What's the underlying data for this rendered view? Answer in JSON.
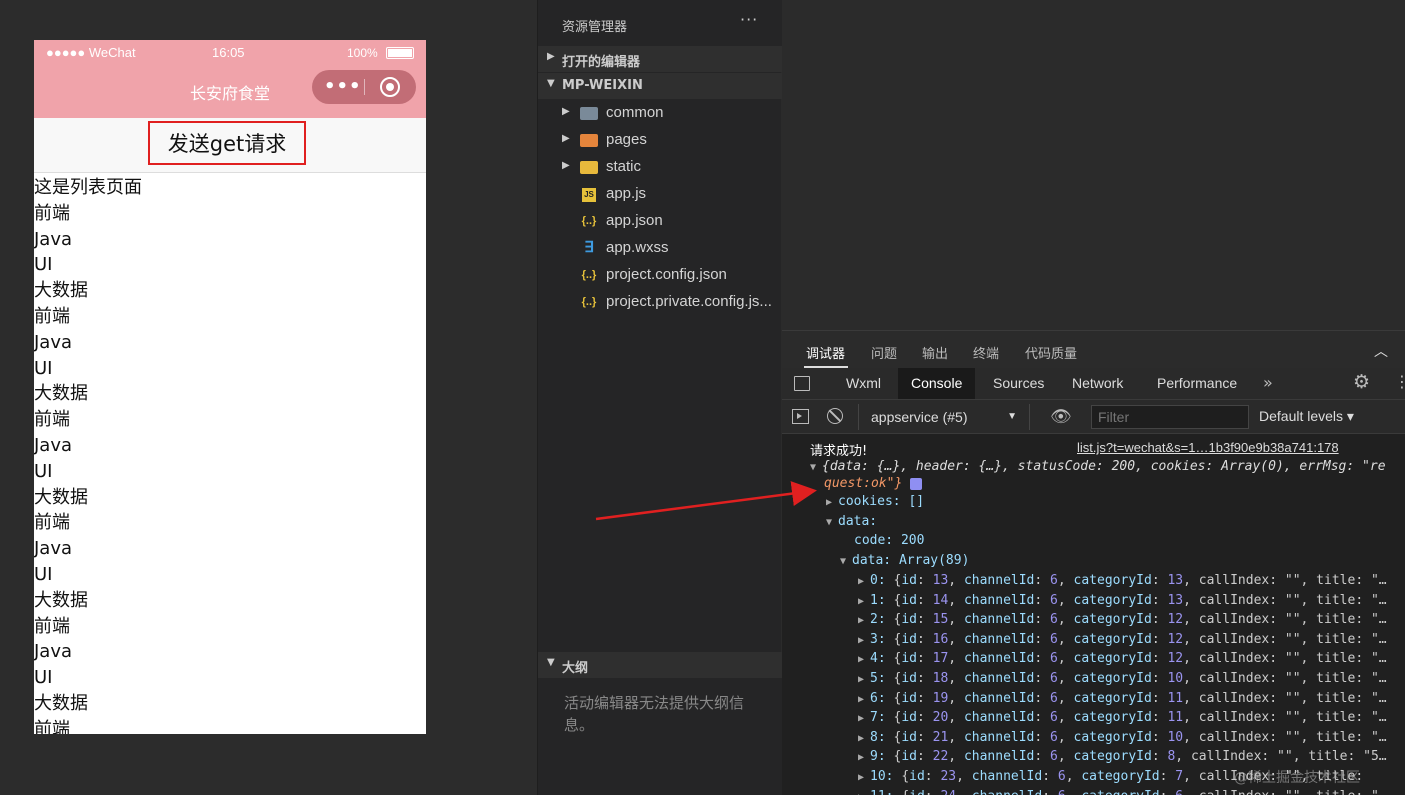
{
  "simulator": {
    "carrier": "●●●●● WeChat",
    "time": "16:05",
    "battery": "100%",
    "nav_title": "长安府食堂",
    "capsule_dots": "•••",
    "button_label": "发送get请求",
    "list_title": "这是列表页面",
    "list_items": [
      "前端",
      "Java",
      "UI",
      "大数据",
      "前端",
      "Java",
      "UI",
      "大数据",
      "前端",
      "Java",
      "UI",
      "大数据",
      "前端",
      "Java",
      "UI",
      "大数据",
      "前端",
      "Java",
      "UI",
      "大数据",
      "前端"
    ]
  },
  "explorer": {
    "title": "资源管理器",
    "more": "···",
    "open_editors": "打开的编辑器",
    "project": "MP-WEIXIN",
    "files": [
      {
        "name": "common",
        "icon": "folder-icon",
        "folder": true
      },
      {
        "name": "pages",
        "icon": "folder-pages-icon",
        "folder": true
      },
      {
        "name": "static",
        "icon": "folder-static-icon",
        "folder": true
      },
      {
        "name": "app.js",
        "icon": "js-file-icon",
        "folder": false
      },
      {
        "name": "app.json",
        "icon": "json-file-icon",
        "folder": false
      },
      {
        "name": "app.wxss",
        "icon": "wxss-file-icon",
        "folder": false
      },
      {
        "name": "project.config.json",
        "icon": "json-file-icon",
        "folder": false
      },
      {
        "name": "project.private.config.js...",
        "icon": "json-file-icon",
        "folder": false
      }
    ],
    "outline": "大纲",
    "outline_msg": "活动编辑器无法提供大纲信息。"
  },
  "debugger": {
    "tabs": [
      "调试器",
      "问题",
      "输出",
      "终端",
      "代码质量"
    ],
    "panel_tabs": [
      "Wxml",
      "Console",
      "Sources",
      "Network",
      "Performance"
    ],
    "active_panel": "Console",
    "context": "appservice (#5)",
    "filter_placeholder": "Filter",
    "levels": "Default levels",
    "success_msg": "请求成功!",
    "source_link": "list.js?t=wechat&s=1…1b3f90e9b38a741:178",
    "summary_line1": "{data: {…}, header: {…}, statusCode: 200, cookies: Array(0), errMsg: \"re",
    "summary_line2": "quest:ok\"}",
    "cookies_line": "cookies: []",
    "data_line": "data:",
    "code_line": "code: 200",
    "array_line": "data: Array(89)",
    "rows": [
      {
        "i": "0",
        "id": 13,
        "channelId": 6,
        "categoryId": 13,
        "tail": "callIndex: \"\", title: \"…"
      },
      {
        "i": "1",
        "id": 14,
        "channelId": 6,
        "categoryId": 13,
        "tail": "callIndex: \"\", title: \"…"
      },
      {
        "i": "2",
        "id": 15,
        "channelId": 6,
        "categoryId": 12,
        "tail": "callIndex: \"\", title: \"…"
      },
      {
        "i": "3",
        "id": 16,
        "channelId": 6,
        "categoryId": 12,
        "tail": "callIndex: \"\", title: \"…"
      },
      {
        "i": "4",
        "id": 17,
        "channelId": 6,
        "categoryId": 12,
        "tail": "callIndex: \"\", title: \"…"
      },
      {
        "i": "5",
        "id": 18,
        "channelId": 6,
        "categoryId": 10,
        "tail": "callIndex: \"\", title: \"…"
      },
      {
        "i": "6",
        "id": 19,
        "channelId": 6,
        "categoryId": 11,
        "tail": "callIndex: \"\", title: \"…"
      },
      {
        "i": "7",
        "id": 20,
        "channelId": 6,
        "categoryId": 11,
        "tail": "callIndex: \"\", title: \"…"
      },
      {
        "i": "8",
        "id": 21,
        "channelId": 6,
        "categoryId": 10,
        "tail": "callIndex: \"\", title: \"…"
      },
      {
        "i": "9",
        "id": 22,
        "channelId": 6,
        "categoryId": 8,
        "tail": "callIndex: \"\", title: \"5…"
      },
      {
        "i": "10",
        "id": 23,
        "channelId": 6,
        "categoryId": 7,
        "tail": "callIndex: \"\", title:"
      },
      {
        "i": "11",
        "id": 24,
        "channelId": 6,
        "categoryId": 6,
        "tail": "callIndex: \"\", title: \"…"
      }
    ],
    "watermark": "@稀土掘金技术社区"
  }
}
